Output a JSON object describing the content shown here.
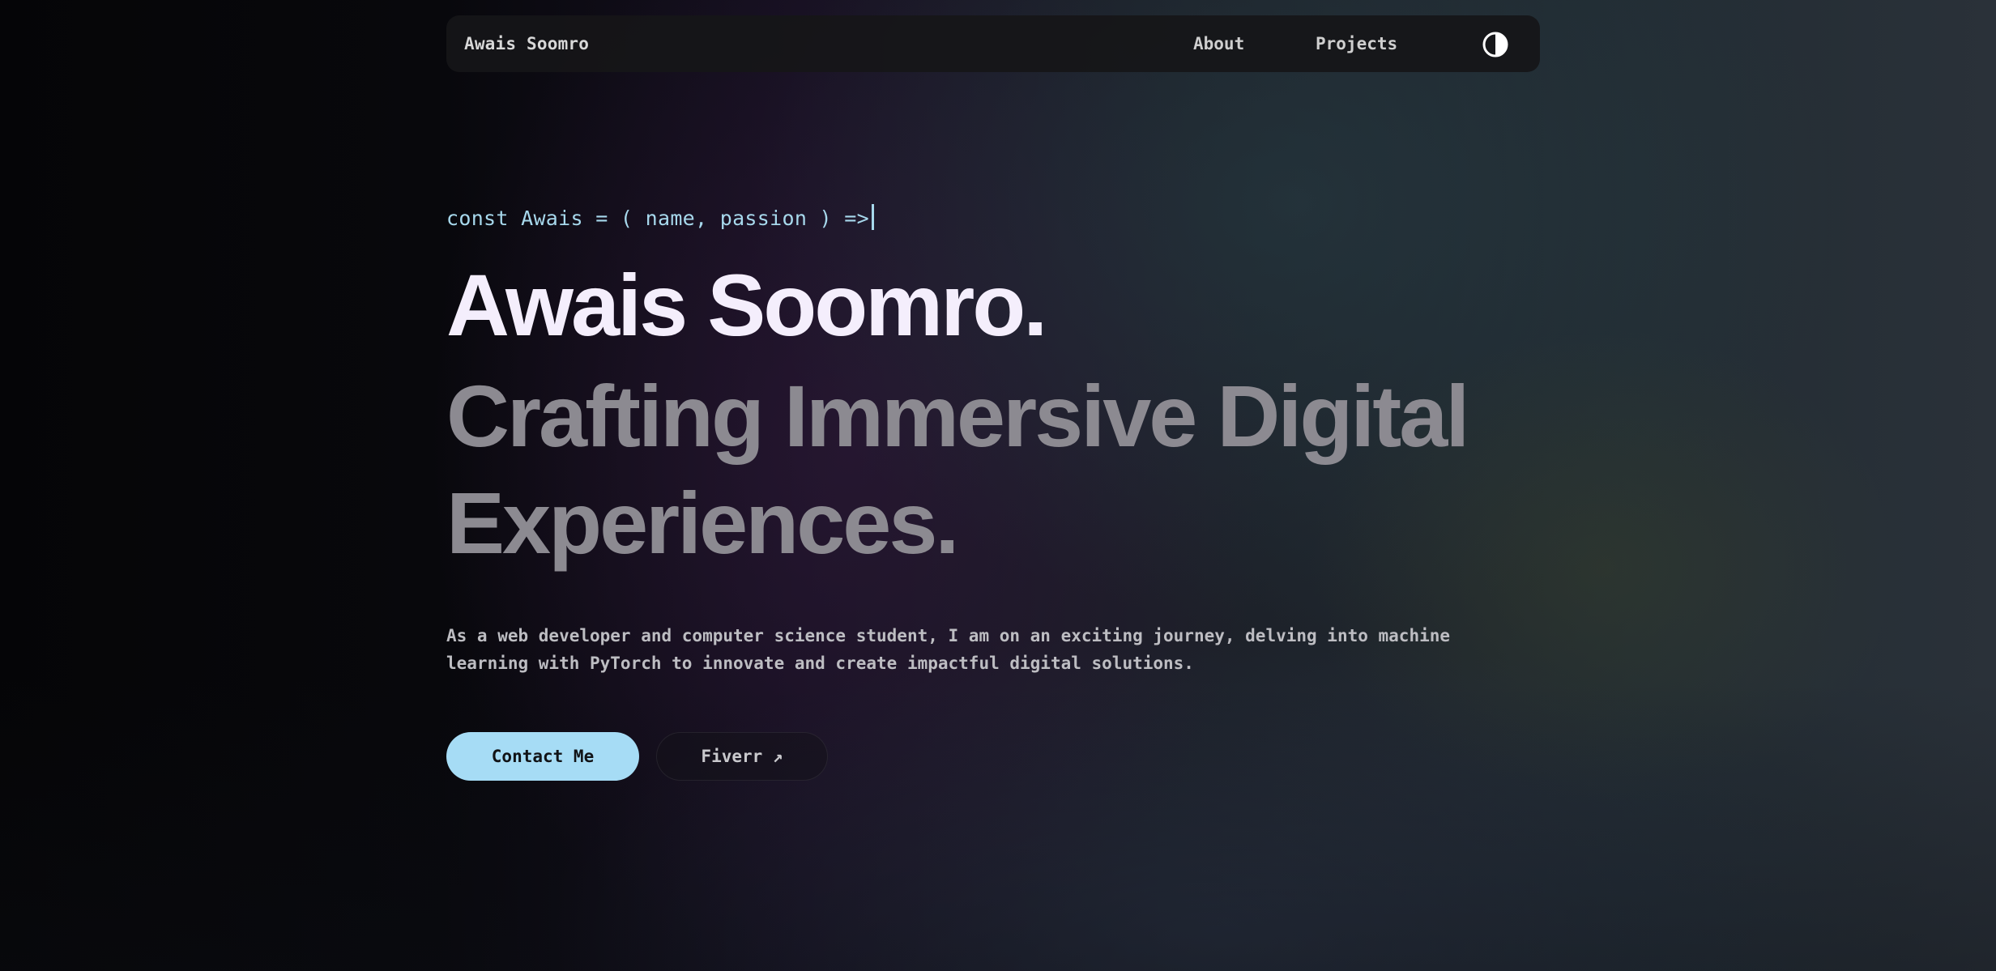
{
  "nav": {
    "brand": "Awais Soomro",
    "links": [
      {
        "label": "About"
      },
      {
        "label": "Projects"
      }
    ],
    "theme_toggle_icon": "contrast-icon"
  },
  "hero": {
    "code_line": "const Awais = ( name, passion ) =>",
    "name": "Awais Soomro.",
    "tagline_line1": "Crafting Immersive Digital",
    "tagline_line2": "Experiences.",
    "description_line1": "As a web developer and computer science student, I am on an exciting journey, delving into machine",
    "description_line2": "learning with PyTorch to innovate and create impactful digital solutions.",
    "buttons": {
      "contact": "Contact Me",
      "fiverr": "Fiverr ↗"
    }
  },
  "colors": {
    "accent": "#a6dcf5",
    "code": "#a7d8ec",
    "heading": "#f4eefc",
    "tagline": "#8c8a91",
    "nav_bg": "#161618"
  }
}
